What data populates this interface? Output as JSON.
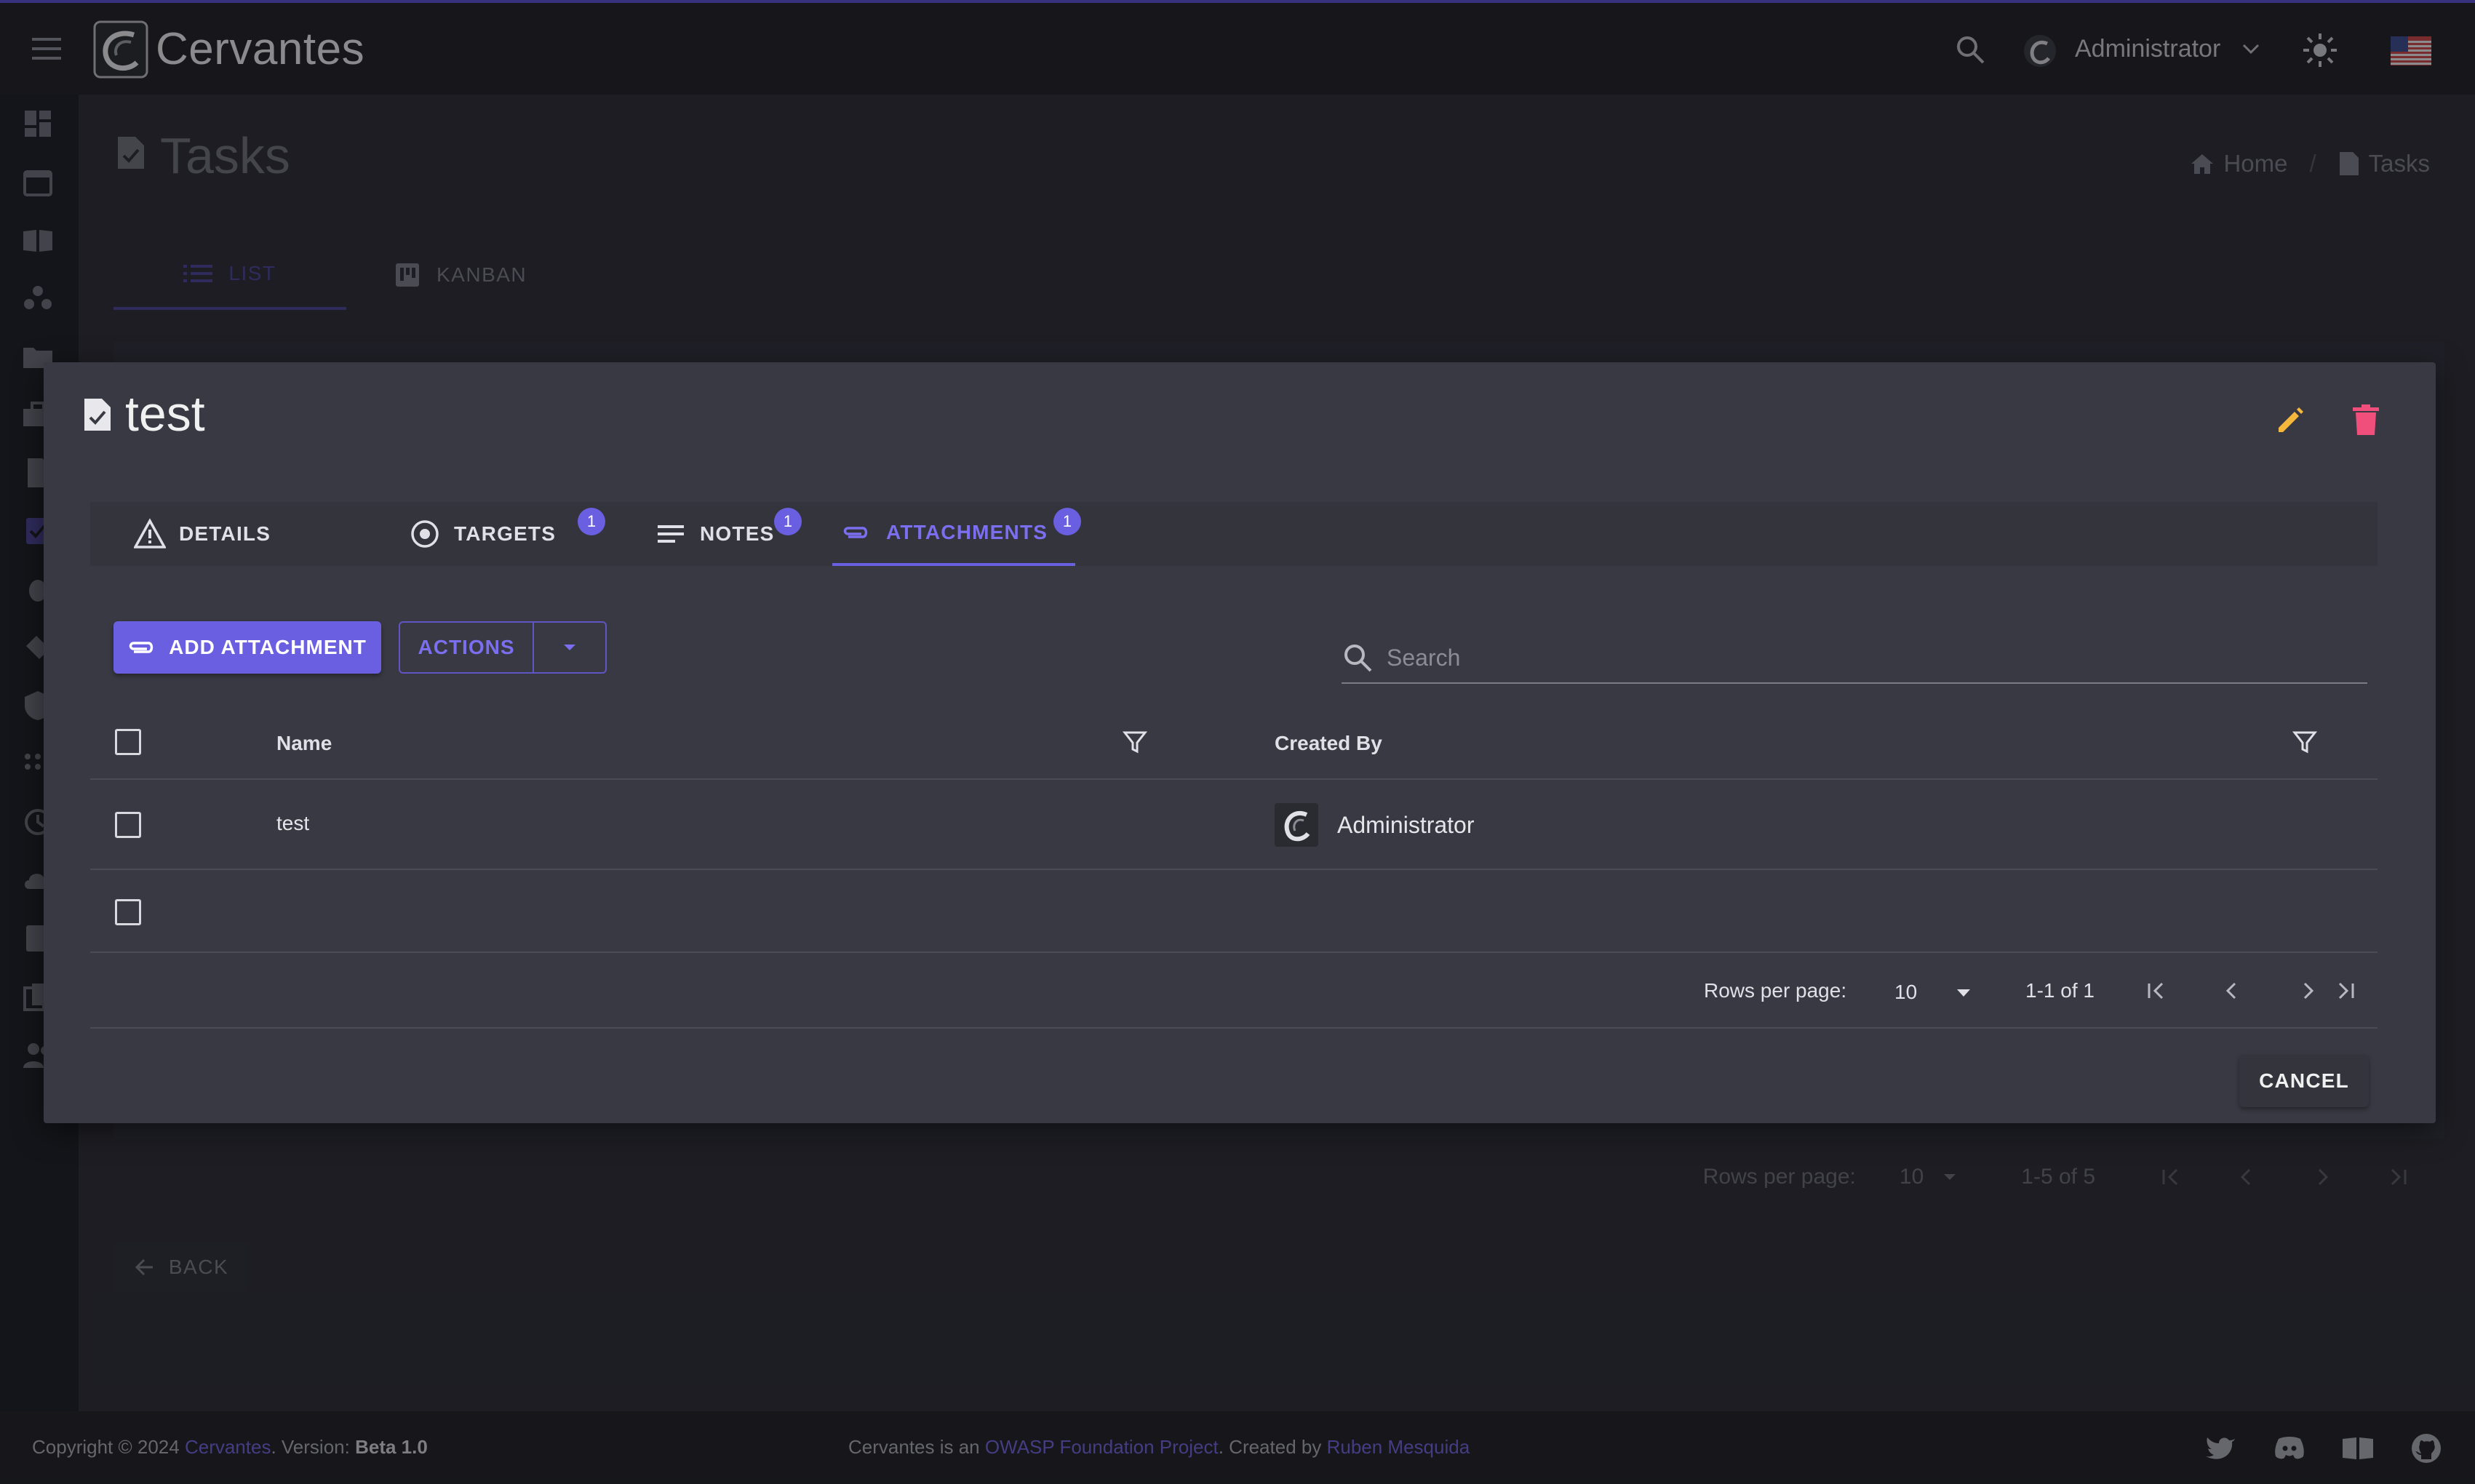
{
  "app": {
    "title": "Cervantes",
    "user": "Administrator"
  },
  "page": {
    "title": "Tasks",
    "breadcrumb": [
      {
        "label": "Home",
        "icon": "home-icon"
      },
      {
        "label": "Tasks",
        "icon": "task-icon"
      }
    ],
    "tabs": [
      {
        "label": "LIST",
        "icon": "list-icon",
        "active": true
      },
      {
        "label": "KANBAN",
        "icon": "kanban-icon",
        "active": false
      }
    ],
    "pagination": {
      "rows_per_page_label": "Rows per page:",
      "rows_per_page": "10",
      "range": "1-5 of 5"
    },
    "back_label": "BACK"
  },
  "modal": {
    "title": "test",
    "tabs": [
      {
        "label": "DETAILS",
        "icon": "warning-icon",
        "badge": ""
      },
      {
        "label": "TARGETS",
        "icon": "target-icon",
        "badge": "1"
      },
      {
        "label": "NOTES",
        "icon": "notes-icon",
        "badge": "1"
      },
      {
        "label": "ATTACHMENTS",
        "icon": "paperclip-icon",
        "badge": "1"
      }
    ],
    "active_tab": "ATTACHMENTS",
    "add_label": "ADD ATTACHMENT",
    "actions_label": "ACTIONS",
    "search_placeholder": "Search",
    "table": {
      "columns": [
        "Name",
        "Created By"
      ],
      "rows": [
        {
          "name": "test",
          "created_by": "Administrator"
        }
      ]
    },
    "pagination": {
      "rows_per_page_label": "Rows per page:",
      "rows_per_page": "10",
      "range": "1-1 of 1"
    },
    "cancel_label": "CANCEL"
  },
  "footer": {
    "copyright": "Copyright © 2024",
    "brand_link": "Cervantes",
    "version_label": ". Version:",
    "version": "Beta 1.0",
    "project_prefix": "Cervantes is an",
    "project_link": "OWASP Foundation Project",
    "created_prefix": ". Created by",
    "author_link": "Ruben Mesquida"
  },
  "colors": {
    "accent": "#6a5fe0",
    "edit": "#f5b83d",
    "delete": "#ef4f7a",
    "background": "#2b2c33",
    "modal": "#383942"
  }
}
